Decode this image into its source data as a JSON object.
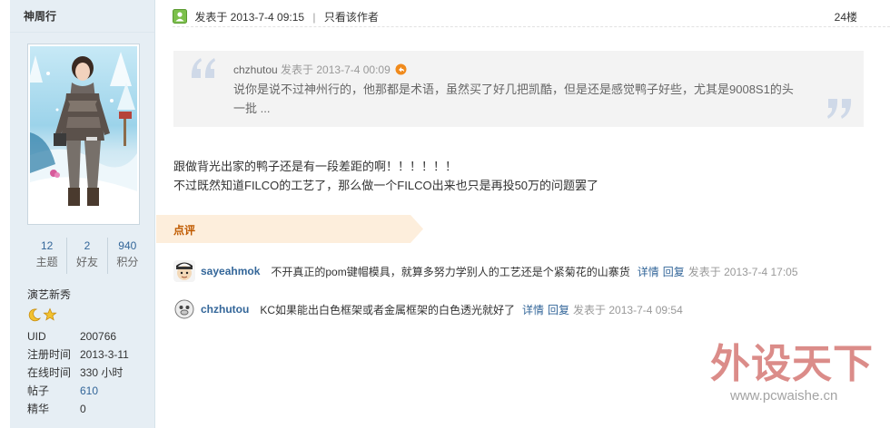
{
  "user": {
    "username": "神周行",
    "stats": [
      {
        "num": "12",
        "label": "主题"
      },
      {
        "num": "2",
        "label": "好友"
      },
      {
        "num": "940",
        "label": "积分"
      }
    ],
    "rank": "演艺新秀",
    "info": [
      {
        "key": "UID",
        "value": "200766"
      },
      {
        "key": "注册时间",
        "value": "2013-3-11"
      },
      {
        "key": "在线时间",
        "value": "330 小时"
      },
      {
        "key": "帖子",
        "value": "610"
      },
      {
        "key": "精华",
        "value": "0"
      }
    ]
  },
  "post": {
    "posted": "发表于 2013-7-4 09:15",
    "separator": "|",
    "only_author": "只看该作者",
    "floor": "24楼",
    "quote": {
      "author": "chzhutou",
      "posted": "发表于 2013-7-4 00:09",
      "body": "说你是说不过神州行的，他那都是术语，虽然买了好几把凯酷，但是还是感觉鸭子好些，尤其是9008S1的头一批 ..."
    },
    "content_lines": [
      "跟做背光出家的鸭子还是有一段差距的啊！！！！！！",
      "不过既然知道FILCO的工艺了，那么做一个FILCO出来也只是再投50万的问题罢了"
    ]
  },
  "comments_title": "点评",
  "comments": [
    {
      "user": "sayeahmok",
      "text": "不开真正的pom键帽模具，就算多努力学别人的工艺还是个紧菊花的山寨货",
      "detail": "详情",
      "reply": "回复",
      "posted": "发表于 2013-7-4 17:05"
    },
    {
      "user": "chzhutou",
      "text": "KC如果能出白色框架或者金属框架的白色透光就好了",
      "detail": "详情",
      "reply": "回复",
      "posted": "发表于 2013-7-4 09:54"
    }
  ],
  "watermark": {
    "title": "外设天下",
    "url": "www.pcwaishe.cn"
  },
  "colors": {
    "sidebar_bg": "#e6eef4",
    "link": "#336699",
    "comment_tab": "#fdeedc",
    "comment_title": "#c05a00",
    "quote_bg": "#f3f3f3"
  }
}
